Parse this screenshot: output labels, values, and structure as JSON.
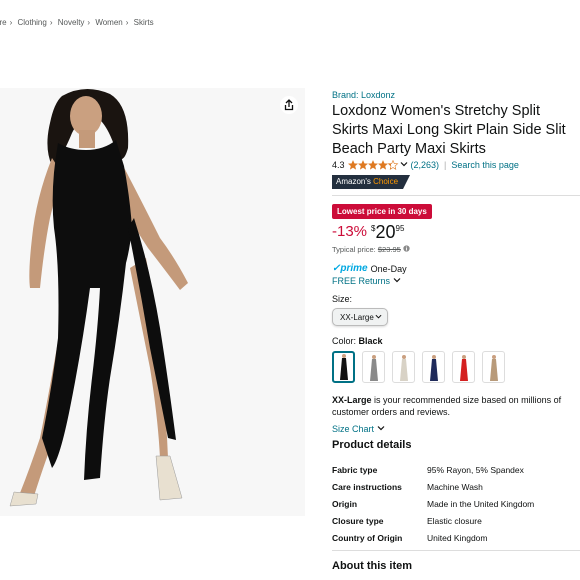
{
  "breadcrumb": [
    "ore",
    "Clothing",
    "Novelty",
    "Women",
    "Skirts"
  ],
  "product": {
    "brand": "Brand: Loxdonz",
    "title": "Loxdonz Women's Stretchy Split Skirts Maxi Long Skirt Plain Side Slit Beach Party Maxi Skirts",
    "rating": "4.3",
    "rating_value": 4.3,
    "ratings_count": "(2,263)",
    "search_link": "Search this page",
    "badge": {
      "part1": "Amazon's ",
      "part2": "Choice"
    },
    "deal_badge": "Lowest price in 30 days",
    "discount": "-13%",
    "currency": "$",
    "price_whole": "20",
    "price_fraction": "95",
    "typical_label": "Typical price:",
    "typical_price": "$23.95",
    "prime_logo": "✓prime",
    "prime_text": "One-Day",
    "returns": "FREE Returns",
    "size_label": "Size:",
    "size_selected": "XX-Large",
    "color_label": "Color:",
    "color_selected": "Black",
    "swatch_colors": [
      "#111111",
      "#8a8a8a",
      "#d8d2c6",
      "#1f2a5a",
      "#d42020",
      "#b89a7a"
    ],
    "recommend_bold": "XX-Large",
    "recommend_text": " is your recommended size based on millions of customer orders and reviews.",
    "size_chart": "Size Chart",
    "details_title": "Product details",
    "details": [
      {
        "k": "Fabric type",
        "v": "95% Rayon, 5% Spandex"
      },
      {
        "k": "Care instructions",
        "v": "Machine Wash"
      },
      {
        "k": "Origin",
        "v": "Made in the United Kingdom"
      },
      {
        "k": "Closure type",
        "v": "Elastic closure"
      },
      {
        "k": "Country of Origin",
        "v": "United Kingdom"
      }
    ],
    "about_title": "About this item"
  },
  "colors": {
    "link": "#007185",
    "deal": "#cc0c39",
    "star": "#de7921",
    "prime": "#00a8e1",
    "badge_bg": "#232f3e"
  },
  "icons": [
    "share-icon",
    "star-icon",
    "chevron-down-icon",
    "info-icon",
    "prime-check-icon"
  ]
}
